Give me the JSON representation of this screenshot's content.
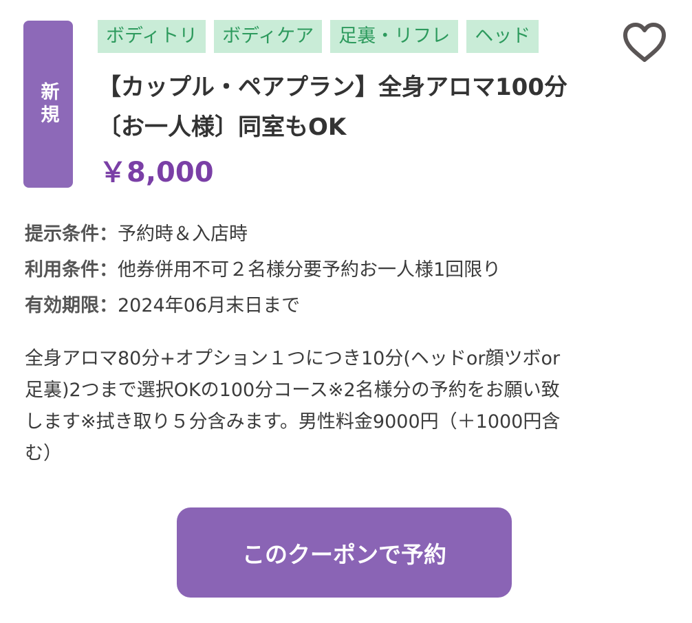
{
  "badge": {
    "label": "新規"
  },
  "tags": [
    "ボディトリ",
    "ボディケア",
    "足裏・リフレ",
    "ヘッド"
  ],
  "favorite": {
    "icon": "heart-icon"
  },
  "coupon": {
    "title_lines": [
      "【カップル・ペアプラン】全身アロマ100分",
      "〔お一人様〕同室もOK"
    ],
    "price": "￥8,000"
  },
  "conditions": [
    {
      "label": "提示条件",
      "value": "予約時＆入店時"
    },
    {
      "label": "利用条件",
      "value": "他券併用不可２名様分要予約お一人様1回限り"
    },
    {
      "label": "有効期限",
      "value": "2024年06月末日まで"
    }
  ],
  "description_lines": [
    "全身アロマ80分+オプション１つにつき10分(ヘッドor顔ツボor",
    "足裏)2つまで選択OKの100分コース※2名様分の予約をお願い致",
    "します※拭き取り５分含みます。男性料金9000円（＋1000円含",
    "む）"
  ],
  "action": {
    "reserve_label": "このクーポンで予約"
  },
  "colors": {
    "badge_bg": "#8d69b8",
    "tag_bg": "#c9ecd7",
    "tag_text": "#2d9a5d",
    "price": "#7a3fa6",
    "button_bg": "#8a64b5"
  }
}
